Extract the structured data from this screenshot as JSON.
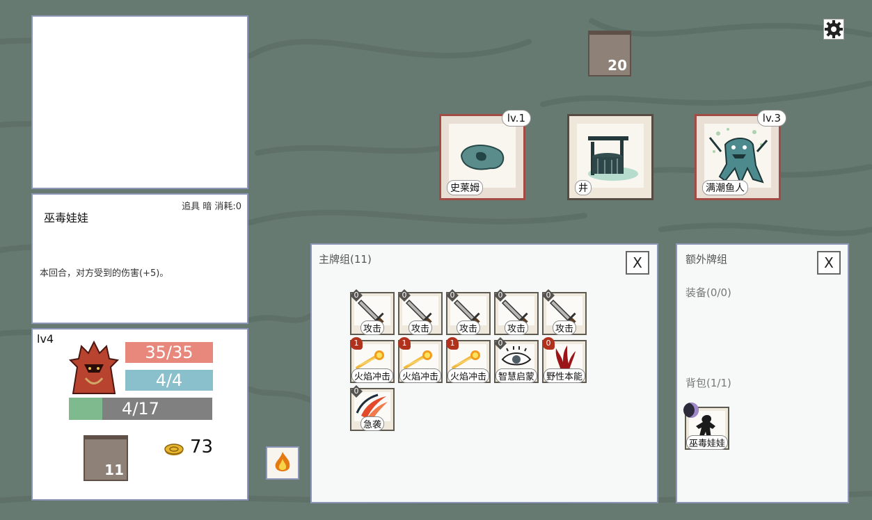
{
  "settings": {
    "icon": "gear-icon"
  },
  "deck_stack": {
    "count": "20"
  },
  "enemies": [
    {
      "name": "史莱姆",
      "level": "lv.1"
    },
    {
      "name": "井",
      "level": ""
    },
    {
      "name": "满潮鱼人",
      "level": "lv.3"
    }
  ],
  "info_card": {
    "title": "巫毒娃娃",
    "meta": "追具 暗 消耗:0",
    "description": "本回合，对方受到的伤害(+5)。"
  },
  "player": {
    "level": "lv4",
    "hp": "35/35",
    "mana": "4/4",
    "exp": "4/17",
    "exp_fraction": 0.235,
    "draw_pile": "11",
    "gold": "73"
  },
  "main_deck": {
    "title": "主牌组(11)",
    "close": "X",
    "cards": [
      {
        "name": "攻击",
        "cost": "0",
        "cost_type": "dark",
        "icon": "sword-icon"
      },
      {
        "name": "攻击",
        "cost": "0",
        "cost_type": "dark",
        "icon": "sword-icon"
      },
      {
        "name": "攻击",
        "cost": "0",
        "cost_type": "dark",
        "icon": "sword-icon"
      },
      {
        "name": "攻击",
        "cost": "0",
        "cost_type": "dark",
        "icon": "sword-icon"
      },
      {
        "name": "攻击",
        "cost": "0",
        "cost_type": "dark",
        "icon": "sword-icon"
      },
      {
        "name": "火焰冲击",
        "cost": "1",
        "cost_type": "red",
        "icon": "fireball-icon"
      },
      {
        "name": "火焰冲击",
        "cost": "1",
        "cost_type": "red",
        "icon": "fireball-icon"
      },
      {
        "name": "火焰冲击",
        "cost": "1",
        "cost_type": "red",
        "icon": "fireball-icon"
      },
      {
        "name": "智慧启蒙",
        "cost": "0",
        "cost_type": "dark",
        "icon": "eye-icon"
      },
      {
        "name": "野性本能",
        "cost": "0",
        "cost_type": "red",
        "icon": "claw-icon"
      },
      {
        "name": "急袭",
        "cost": "0",
        "cost_type": "dark",
        "icon": "slash-icon"
      }
    ]
  },
  "extra_deck": {
    "title": "额外牌组",
    "close": "X",
    "equipment": "装备(0/0)",
    "bag": "背包(1/1)",
    "items": [
      {
        "name": "巫毒娃娃",
        "icon": "voodoo-doll-icon"
      }
    ]
  },
  "skill_button": {
    "icon": "fire-icon"
  }
}
